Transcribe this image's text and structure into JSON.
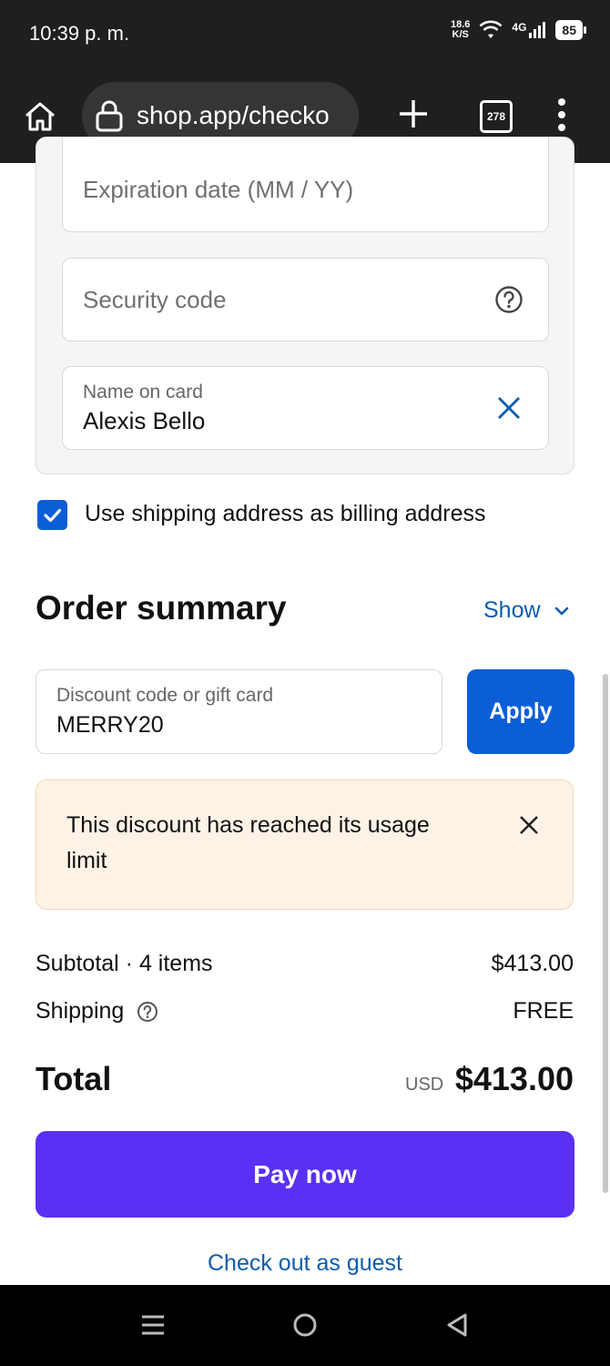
{
  "status_bar": {
    "time": "10:39 p. m.",
    "net_speed_top": "18.6",
    "net_speed_bottom": "K/S",
    "network": "4G",
    "battery": "85"
  },
  "browser": {
    "url": "shop.app/checko",
    "tab_count": "278"
  },
  "card_form": {
    "expiration_placeholder": "Expiration date (MM / YY)",
    "security_placeholder": "Security code",
    "name_label": "Name on card",
    "name_value": "Alexis Bello"
  },
  "billing": {
    "checkbox_label": "Use shipping address as billing address",
    "checked": true
  },
  "order_summary": {
    "title": "Order summary",
    "toggle_label": "Show"
  },
  "discount": {
    "label": "Discount code or gift card",
    "value": "MERRY20",
    "apply_label": "Apply",
    "alert_text": "This discount has reached its usage limit"
  },
  "totals": {
    "subtotal_label": "Subtotal · 4 items",
    "subtotal_value": "$413.00",
    "shipping_label": "Shipping",
    "shipping_value": "FREE",
    "total_label": "Total",
    "currency": "USD",
    "total_value": "$413.00"
  },
  "actions": {
    "pay_label": "Pay now",
    "guest_label": "Check out as guest"
  },
  "colors": {
    "accent_blue": "#0b5ed7",
    "pay_purple": "#5a31f4",
    "alert_bg": "#fdf2e6"
  }
}
